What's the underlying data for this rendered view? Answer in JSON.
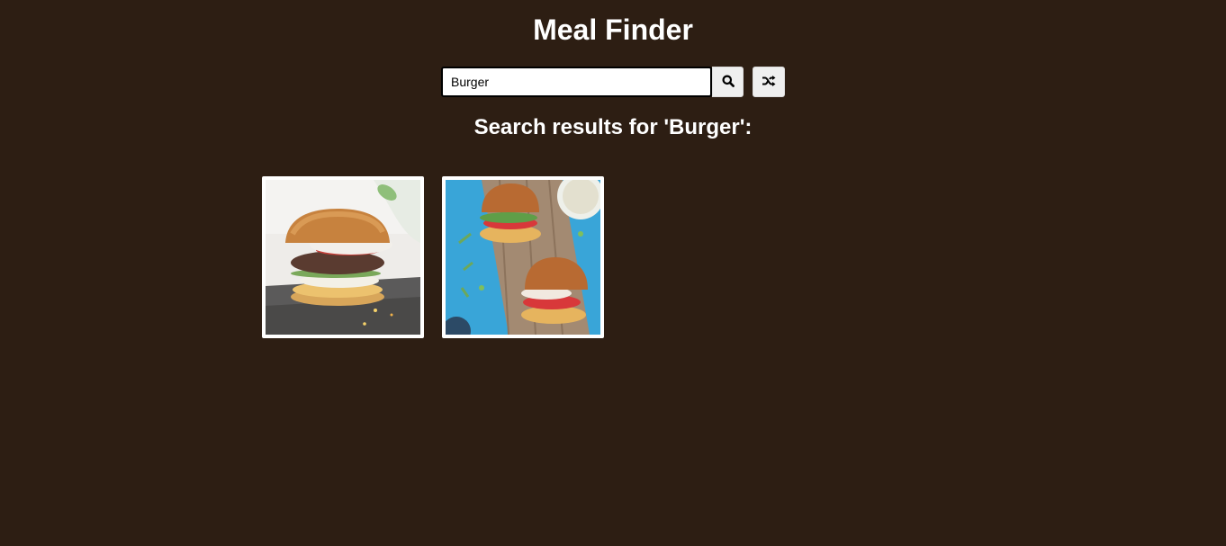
{
  "app": {
    "title": "Meal Finder"
  },
  "search": {
    "value": "Burger",
    "search_icon": "search-icon",
    "random_icon": "shuffle-icon"
  },
  "results": {
    "heading": "Search results for 'Burger':",
    "meals": [
      {
        "image": "burger-photo"
      },
      {
        "image": "burgers-on-board-photo"
      }
    ]
  },
  "colors": {
    "background": "#2d1e13",
    "text": "#ffffff",
    "button": "#efefef"
  }
}
